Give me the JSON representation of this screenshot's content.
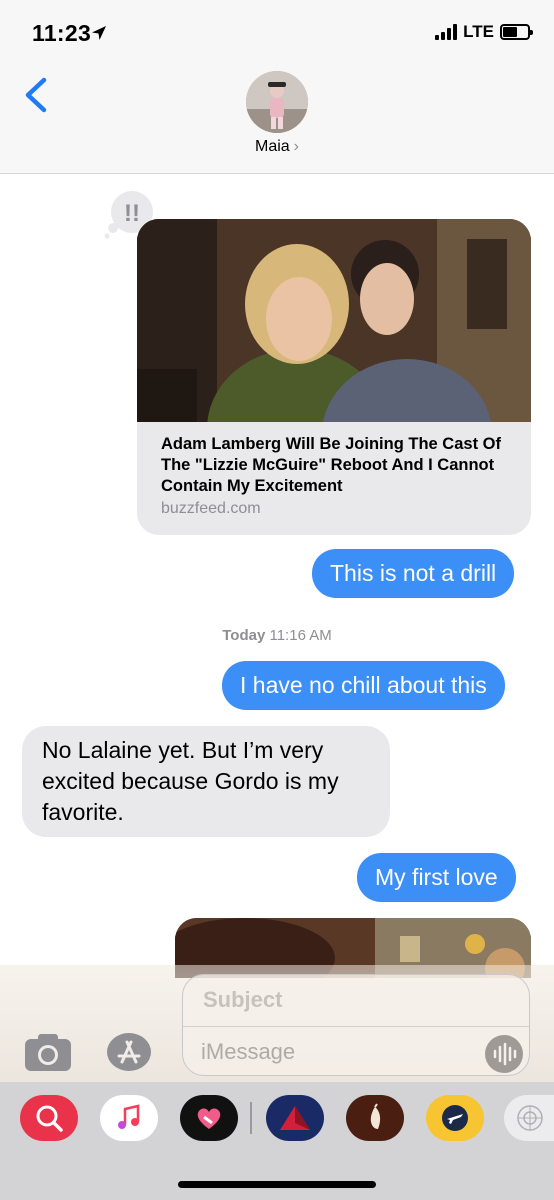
{
  "status_bar": {
    "time": "11:23",
    "network": "LTE"
  },
  "header": {
    "contact_name": "Maia",
    "chevron": "›"
  },
  "messages": {
    "link_preview": {
      "title": "Adam Lamberg Will Be Joining The Cast Of The \"Lizzie McGuire\" Reboot And I Cannot Contain My Excitement",
      "domain": "buzzfeed.com",
      "tapback": "!!"
    },
    "bubble_1": "This is not a drill",
    "timestamp_day": "Today",
    "timestamp_time": "11:16 AM",
    "bubble_2": "I have no chill about this",
    "bubble_3": "No Lalaine yet. But I’m very excited because Gordo is my favorite.",
    "bubble_4": "My first love"
  },
  "compose": {
    "subject_placeholder": "Subject",
    "message_placeholder": "iMessage"
  },
  "colors": {
    "outgoing_bubble": "#3b8ff6",
    "incoming_bubble": "#e9e9eb",
    "accent": "#007aff"
  },
  "app_drawer": {
    "icons": [
      "search-images-icon",
      "music-icon",
      "heart-stickers-icon",
      "delta-icon",
      "chipotle-icon",
      "flight-icon",
      "more-apps-icon"
    ]
  }
}
